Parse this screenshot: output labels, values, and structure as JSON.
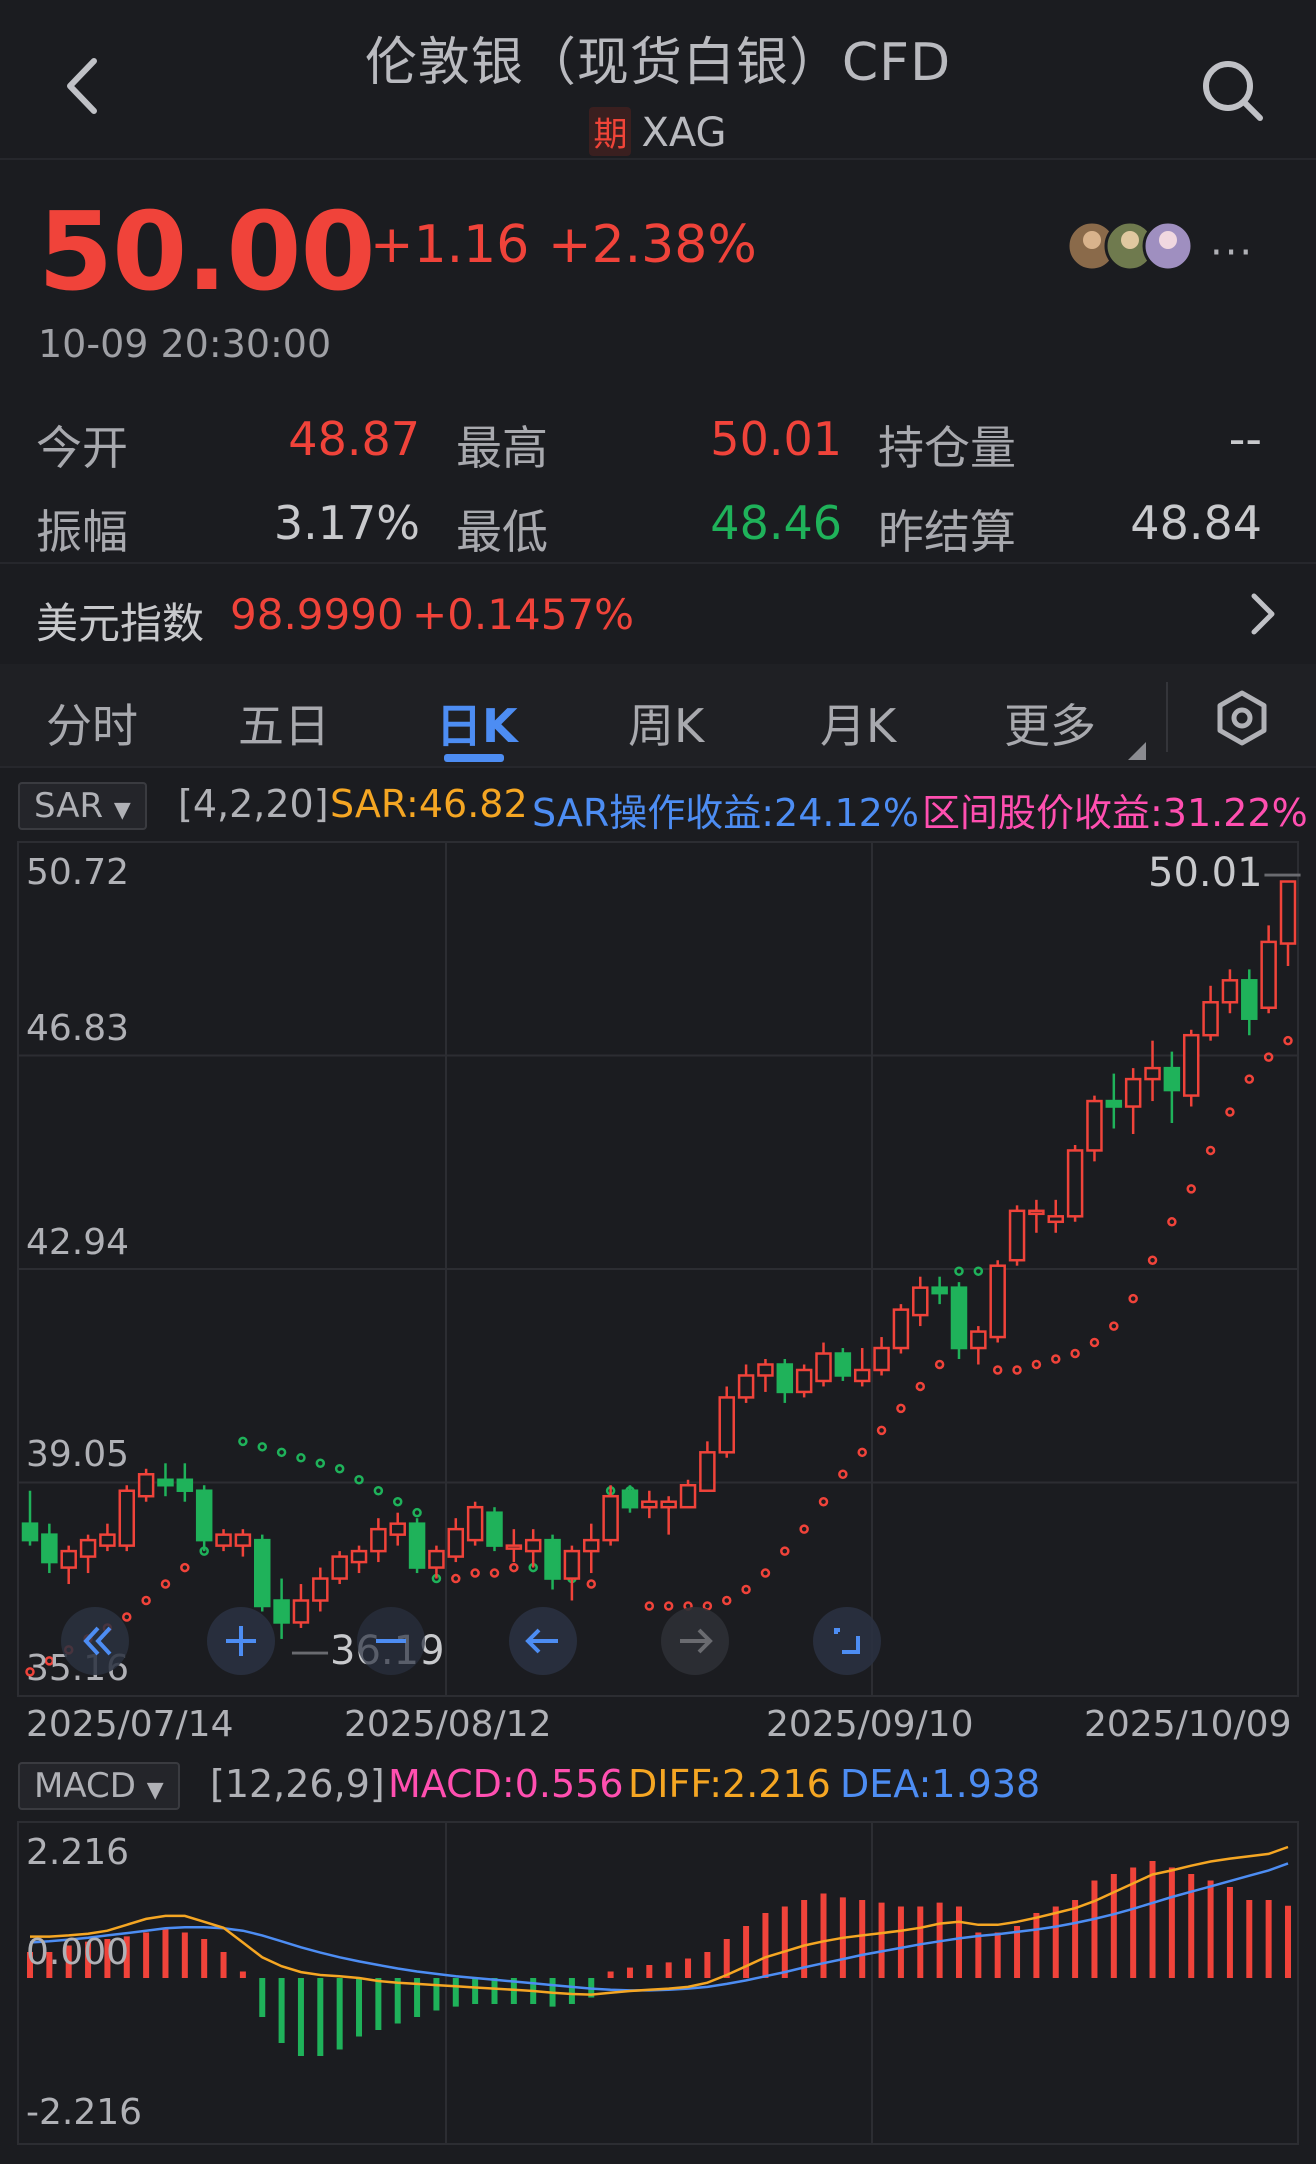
{
  "header": {
    "title": "伦敦银（现货白银）CFD",
    "badge": "期",
    "symbol": "XAG"
  },
  "quote": {
    "price": "50.00",
    "change": "+1.16",
    "change_pct": "+2.38%",
    "time": "10-09 20:30:00",
    "more": "···"
  },
  "stats": {
    "open_label": "今开",
    "open": "48.87",
    "high_label": "最高",
    "high": "50.01",
    "oi_label": "持仓量",
    "oi": "--",
    "amp_label": "振幅",
    "amp": "3.17%",
    "low_label": "最低",
    "low": "48.46",
    "prev_label": "昨结算",
    "prev": "48.84"
  },
  "usd_index": {
    "label": "美元指数",
    "value": "98.9990",
    "change": "+0.1457%"
  },
  "tabs": [
    "分时",
    "五日",
    "日K",
    "周K",
    "月K",
    "更多"
  ],
  "active_tab": "日K",
  "sar_bar": {
    "button": "SAR",
    "params": "[4,2,20]",
    "sar": "SAR:46.82",
    "op_return": "SAR操作收益:24.12%",
    "range_return": "区间股价收益:31.22%"
  },
  "price_chart": {
    "ymax_label": "50.72",
    "y2_label": "46.83",
    "y3_label": "42.94",
    "y4_label": "39.05",
    "ymin_label": "35.16",
    "high_marker": "50.01",
    "low_marker": "36.19",
    "dates": [
      "2025/07/14",
      "2025/08/12",
      "2025/09/10",
      "2025/10/09"
    ]
  },
  "macd_bar": {
    "button": "MACD",
    "params": "[12,26,9]",
    "macd": "MACD:0.556",
    "diff": "DIFF:2.216",
    "dea": "DEA:1.938"
  },
  "macd_axis": {
    "top": "2.216",
    "zero": "0.000",
    "bottom": "-2.216"
  },
  "colors": {
    "up": "#f0433a",
    "down": "#1fb25a",
    "accent": "#4d8df3",
    "sar_up": "#f0433a",
    "diff": "#f5a623",
    "dea": "#4d8df3",
    "macd_label": "#ff4fb0"
  },
  "chart_data": {
    "type": "candlestick",
    "ylim": [
      35.16,
      50.72
    ],
    "candles": [
      {
        "o": 38.3,
        "h": 38.9,
        "l": 37.9,
        "c": 38.0
      },
      {
        "o": 38.1,
        "h": 38.3,
        "l": 37.4,
        "c": 37.6
      },
      {
        "o": 37.5,
        "h": 37.9,
        "l": 37.2,
        "c": 37.8
      },
      {
        "o": 37.7,
        "h": 38.1,
        "l": 37.4,
        "c": 38.0
      },
      {
        "o": 37.9,
        "h": 38.3,
        "l": 37.8,
        "c": 38.1
      },
      {
        "o": 37.9,
        "h": 39.0,
        "l": 37.8,
        "c": 38.9
      },
      {
        "o": 38.8,
        "h": 39.3,
        "l": 38.7,
        "c": 39.2
      },
      {
        "o": 39.1,
        "h": 39.4,
        "l": 38.8,
        "c": 39.0
      },
      {
        "o": 39.1,
        "h": 39.4,
        "l": 38.7,
        "c": 38.9
      },
      {
        "o": 38.9,
        "h": 39.0,
        "l": 37.8,
        "c": 38.0
      },
      {
        "o": 37.9,
        "h": 38.2,
        "l": 37.8,
        "c": 38.1
      },
      {
        "o": 37.9,
        "h": 38.2,
        "l": 37.7,
        "c": 38.1
      },
      {
        "o": 38.0,
        "h": 38.1,
        "l": 36.7,
        "c": 36.8
      },
      {
        "o": 36.9,
        "h": 37.3,
        "l": 36.2,
        "c": 36.5
      },
      {
        "o": 36.5,
        "h": 37.2,
        "l": 36.4,
        "c": 36.9
      },
      {
        "o": 36.9,
        "h": 37.5,
        "l": 36.7,
        "c": 37.3
      },
      {
        "o": 37.3,
        "h": 37.8,
        "l": 37.2,
        "c": 37.7
      },
      {
        "o": 37.6,
        "h": 37.9,
        "l": 37.4,
        "c": 37.8
      },
      {
        "o": 37.8,
        "h": 38.4,
        "l": 37.6,
        "c": 38.2
      },
      {
        "o": 38.1,
        "h": 38.5,
        "l": 37.9,
        "c": 38.3
      },
      {
        "o": 38.3,
        "h": 38.4,
        "l": 37.4,
        "c": 37.5
      },
      {
        "o": 37.5,
        "h": 37.9,
        "l": 37.3,
        "c": 37.8
      },
      {
        "o": 37.7,
        "h": 38.4,
        "l": 37.6,
        "c": 38.2
      },
      {
        "o": 38.0,
        "h": 38.7,
        "l": 37.9,
        "c": 38.6
      },
      {
        "o": 38.5,
        "h": 38.6,
        "l": 37.8,
        "c": 37.9
      },
      {
        "o": 37.9,
        "h": 38.2,
        "l": 37.6,
        "c": 37.9
      },
      {
        "o": 37.8,
        "h": 38.2,
        "l": 37.5,
        "c": 38.0
      },
      {
        "o": 38.0,
        "h": 38.1,
        "l": 37.1,
        "c": 37.3
      },
      {
        "o": 37.3,
        "h": 37.9,
        "l": 36.9,
        "c": 37.8
      },
      {
        "o": 37.8,
        "h": 38.3,
        "l": 37.4,
        "c": 38.0
      },
      {
        "o": 38.0,
        "h": 39.0,
        "l": 37.9,
        "c": 38.8
      },
      {
        "o": 38.9,
        "h": 39.0,
        "l": 38.5,
        "c": 38.6
      },
      {
        "o": 38.6,
        "h": 38.9,
        "l": 38.4,
        "c": 38.7
      },
      {
        "o": 38.6,
        "h": 38.8,
        "l": 38.1,
        "c": 38.7
      },
      {
        "o": 38.6,
        "h": 39.1,
        "l": 38.6,
        "c": 39.0
      },
      {
        "o": 38.9,
        "h": 39.8,
        "l": 38.9,
        "c": 39.6
      },
      {
        "o": 39.6,
        "h": 40.8,
        "l": 39.5,
        "c": 40.6
      },
      {
        "o": 40.6,
        "h": 41.2,
        "l": 40.5,
        "c": 41.0
      },
      {
        "o": 41.0,
        "h": 41.3,
        "l": 40.7,
        "c": 41.2
      },
      {
        "o": 41.2,
        "h": 41.3,
        "l": 40.5,
        "c": 40.7
      },
      {
        "o": 40.7,
        "h": 41.2,
        "l": 40.6,
        "c": 41.1
      },
      {
        "o": 40.9,
        "h": 41.6,
        "l": 40.8,
        "c": 41.4
      },
      {
        "o": 41.4,
        "h": 41.5,
        "l": 40.9,
        "c": 41.0
      },
      {
        "o": 40.9,
        "h": 41.5,
        "l": 40.8,
        "c": 41.1
      },
      {
        "o": 41.1,
        "h": 41.7,
        "l": 41.0,
        "c": 41.5
      },
      {
        "o": 41.5,
        "h": 42.3,
        "l": 41.4,
        "c": 42.2
      },
      {
        "o": 42.1,
        "h": 42.8,
        "l": 41.9,
        "c": 42.6
      },
      {
        "o": 42.6,
        "h": 42.8,
        "l": 42.3,
        "c": 42.5
      },
      {
        "o": 42.6,
        "h": 42.7,
        "l": 41.3,
        "c": 41.5
      },
      {
        "o": 41.5,
        "h": 41.9,
        "l": 41.2,
        "c": 41.8
      },
      {
        "o": 41.7,
        "h": 43.1,
        "l": 41.6,
        "c": 43.0
      },
      {
        "o": 43.1,
        "h": 44.1,
        "l": 43.0,
        "c": 44.0
      },
      {
        "o": 44.0,
        "h": 44.2,
        "l": 43.6,
        "c": 44.0
      },
      {
        "o": 43.8,
        "h": 44.2,
        "l": 43.6,
        "c": 43.9
      },
      {
        "o": 43.9,
        "h": 45.2,
        "l": 43.8,
        "c": 45.1
      },
      {
        "o": 45.1,
        "h": 46.1,
        "l": 44.9,
        "c": 46.0
      },
      {
        "o": 46.0,
        "h": 46.5,
        "l": 45.5,
        "c": 45.9
      },
      {
        "o": 45.9,
        "h": 46.6,
        "l": 45.4,
        "c": 46.4
      },
      {
        "o": 46.4,
        "h": 47.1,
        "l": 46.0,
        "c": 46.6
      },
      {
        "o": 46.6,
        "h": 46.9,
        "l": 45.6,
        "c": 46.2
      },
      {
        "o": 46.1,
        "h": 47.3,
        "l": 45.9,
        "c": 47.2
      },
      {
        "o": 47.2,
        "h": 48.1,
        "l": 47.1,
        "c": 47.8
      },
      {
        "o": 47.8,
        "h": 48.4,
        "l": 47.6,
        "c": 48.2
      },
      {
        "o": 48.2,
        "h": 48.4,
        "l": 47.2,
        "c": 47.5
      },
      {
        "o": 47.7,
        "h": 49.2,
        "l": 47.6,
        "c": 48.9
      },
      {
        "o": 48.87,
        "h": 50.01,
        "l": 48.46,
        "c": 50.0
      }
    ],
    "sar": [
      35.6,
      35.8,
      36.0,
      36.2,
      36.4,
      36.6,
      36.9,
      37.2,
      37.5,
      37.8,
      38.0,
      39.8,
      39.7,
      39.6,
      39.5,
      39.4,
      39.3,
      39.1,
      38.9,
      38.7,
      38.5,
      37.3,
      37.3,
      37.4,
      37.4,
      37.5,
      37.5,
      37.4,
      37.3,
      37.2,
      38.9,
      38.9,
      36.8,
      36.8,
      36.8,
      36.8,
      36.9,
      37.1,
      37.4,
      37.8,
      38.2,
      38.7,
      39.2,
      39.6,
      40.0,
      40.4,
      40.8,
      41.2,
      42.9,
      42.9,
      41.1,
      41.1,
      41.2,
      41.3,
      41.4,
      41.6,
      41.9,
      42.4,
      43.1,
      43.8,
      44.4,
      45.1,
      45.8,
      46.4,
      46.8,
      47.1
    ],
    "macd_hist": [
      0.2,
      0.2,
      0.25,
      0.28,
      0.3,
      0.32,
      0.35,
      0.38,
      0.35,
      0.3,
      0.2,
      0.05,
      -0.3,
      -0.5,
      -0.6,
      -0.6,
      -0.55,
      -0.45,
      -0.4,
      -0.35,
      -0.3,
      -0.25,
      -0.22,
      -0.2,
      -0.2,
      -0.2,
      -0.2,
      -0.22,
      -0.2,
      -0.15,
      0.05,
      0.08,
      0.1,
      0.12,
      0.15,
      0.2,
      0.3,
      0.4,
      0.5,
      0.55,
      0.6,
      0.65,
      0.62,
      0.6,
      0.58,
      0.55,
      0.55,
      0.58,
      0.55,
      0.35,
      0.35,
      0.4,
      0.5,
      0.55,
      0.6,
      0.75,
      0.8,
      0.85,
      0.9,
      0.85,
      0.8,
      0.75,
      0.7,
      0.6,
      0.6,
      0.556
    ],
    "diff": [
      0.7,
      0.7,
      0.72,
      0.75,
      0.8,
      0.9,
      1.0,
      1.05,
      1.05,
      0.95,
      0.85,
      0.6,
      0.35,
      0.2,
      0.1,
      0.05,
      0.03,
      0.0,
      -0.05,
      -0.08,
      -0.1,
      -0.12,
      -0.14,
      -0.16,
      -0.18,
      -0.2,
      -0.22,
      -0.25,
      -0.27,
      -0.28,
      -0.25,
      -0.22,
      -0.2,
      -0.18,
      -0.15,
      -0.08,
      0.05,
      0.2,
      0.35,
      0.45,
      0.55,
      0.62,
      0.68,
      0.72,
      0.76,
      0.8,
      0.85,
      0.92,
      0.95,
      0.9,
      0.9,
      0.95,
      1.02,
      1.1,
      1.18,
      1.3,
      1.45,
      1.6,
      1.75,
      1.82,
      1.9,
      1.97,
      2.02,
      2.06,
      2.1,
      2.216
    ],
    "dea": [
      0.6,
      0.62,
      0.65,
      0.68,
      0.72,
      0.76,
      0.8,
      0.84,
      0.86,
      0.86,
      0.84,
      0.8,
      0.72,
      0.62,
      0.52,
      0.43,
      0.35,
      0.28,
      0.22,
      0.16,
      0.11,
      0.07,
      0.03,
      0.0,
      -0.03,
      -0.06,
      -0.09,
      -0.12,
      -0.15,
      -0.18,
      -0.2,
      -0.21,
      -0.21,
      -0.2,
      -0.18,
      -0.15,
      -0.1,
      -0.04,
      0.03,
      0.1,
      0.18,
      0.25,
      0.32,
      0.39,
      0.45,
      0.51,
      0.57,
      0.62,
      0.67,
      0.71,
      0.74,
      0.78,
      0.82,
      0.87,
      0.93,
      1.0,
      1.08,
      1.17,
      1.27,
      1.37,
      1.46,
      1.55,
      1.64,
      1.73,
      1.82,
      1.938
    ],
    "macd_ylim": [
      -2.216,
      2.216
    ]
  }
}
